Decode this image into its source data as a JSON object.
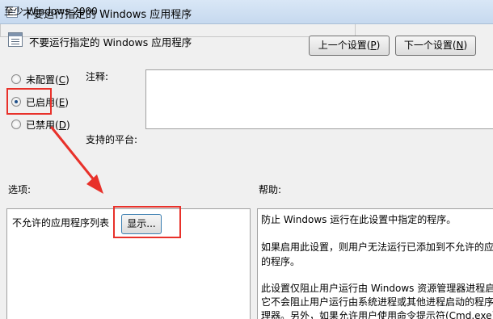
{
  "window": {
    "title": "不要运行指定的 Windows 应用程序"
  },
  "header": {
    "title": "不要运行指定的 Windows 应用程序",
    "prev_button": {
      "text": "上一个设置(",
      "key": "P",
      "end": ")"
    },
    "next_button": {
      "text": "下一个设置(",
      "key": "N",
      "end": ")"
    }
  },
  "state": {
    "options": [
      {
        "text": "未配置(",
        "key": "C",
        "end": ")",
        "checked": false
      },
      {
        "text": "已启用(",
        "key": "E",
        "end": ")",
        "checked": true
      },
      {
        "text": "已禁用(",
        "key": "D",
        "end": ")",
        "checked": false
      }
    ]
  },
  "comment": {
    "label": "注释:"
  },
  "platform": {
    "label": "支持的平台:",
    "value": "至少 Windows 2000"
  },
  "sections": {
    "options_label": "选项:",
    "help_label": "帮助:"
  },
  "options_panel": {
    "item_label": "不允许的应用程序列表",
    "show_button": "显示..."
  },
  "help": {
    "lines": [
      "防止 Windows 运行在此设置中指定的程序。",
      "如果启用此设置，则用户无法运行已添加到不允许的应",
      "的程序。",
      "此设置仅阻止用户运行由 Windows 资源管理器进程启",
      "它不会阻止用户运行由系统进程或其他进程启动的程序",
      "理器。另外，如果允许用户使用命令提示符(Cmd.exe)"
    ]
  },
  "colors": {
    "highlight": "#e8312a",
    "titlebar": "#c6d9ef",
    "background": "#f0f0f0"
  }
}
